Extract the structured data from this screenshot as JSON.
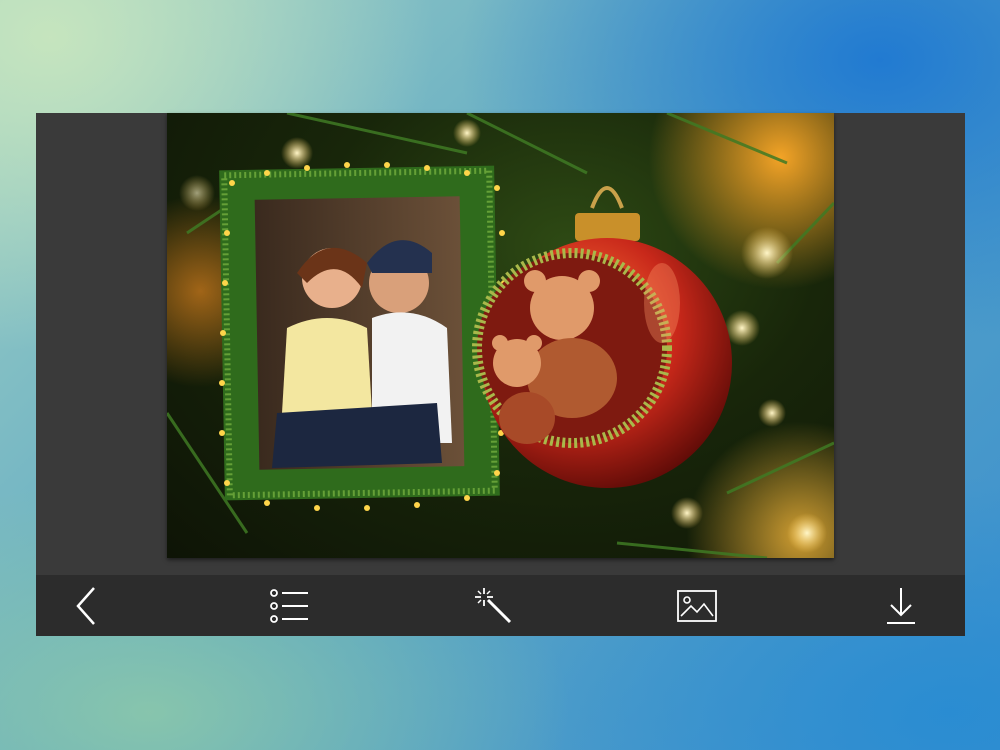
{
  "editor": {
    "photo": {
      "description_icon": "christmas-frame-photo",
      "accent_colors": [
        "#2f6b1c",
        "#c8281a",
        "#f2b53a"
      ]
    },
    "toolbar": {
      "items": [
        {
          "icon": "back-arrow-icon",
          "label": ""
        },
        {
          "icon": "list-icon",
          "label": ""
        },
        {
          "icon": "magic-wand-icon",
          "label": ""
        },
        {
          "icon": "image-icon",
          "label": ""
        },
        {
          "icon": "download-icon",
          "label": ""
        }
      ],
      "icon_color": "#ffffff",
      "background": "#2c2c2c"
    }
  }
}
